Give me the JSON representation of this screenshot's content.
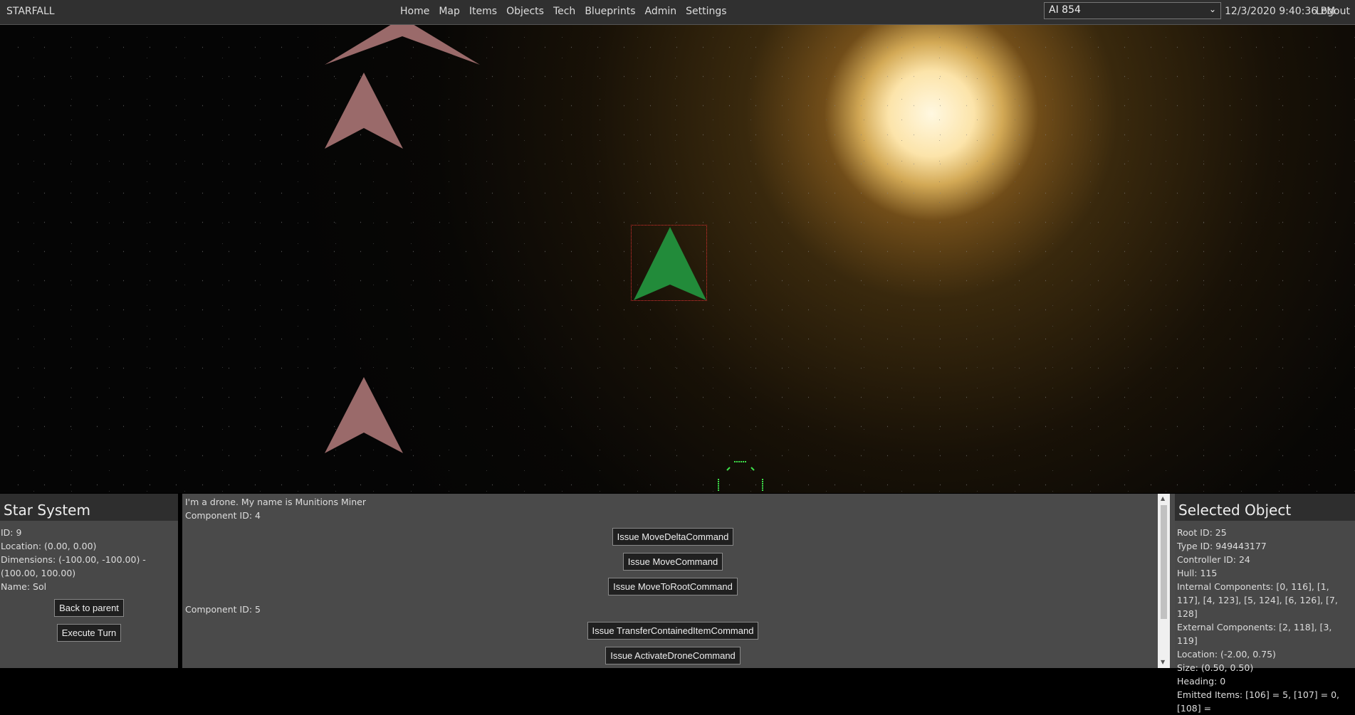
{
  "navbar": {
    "brand": "STARFALL",
    "links": [
      "Home",
      "Map",
      "Items",
      "Objects",
      "Tech",
      "Blueprints",
      "Admin",
      "Settings"
    ],
    "user_select": "AI 854",
    "clock": "12/3/2020 9:40:36 PM",
    "logout": "Logout"
  },
  "viewport": {
    "colors": {
      "sun_core": "#fff8e1",
      "sun_glow": "#c08a30",
      "enemy_ship": "#9a6a6a",
      "player_ship": "#228b3a",
      "selection": "#e03030",
      "hud": "#3ee04a"
    }
  },
  "star_system": {
    "title": "Star System",
    "id": "ID: 9",
    "location": "Location: (0.00, 0.00)",
    "dimensions": "Dimensions: (-100.00, -100.00) - (100.00, 100.00)",
    "name": "Name: Sol",
    "back_button": "Back to parent",
    "execute_button": "Execute Turn"
  },
  "drone": {
    "intro": "I'm a drone. My name is Munitions Miner",
    "component4": "Component ID: 4",
    "btn_move_delta": "Issue MoveDeltaCommand",
    "btn_move": "Issue MoveCommand",
    "btn_move_root": "Issue MoveToRootCommand",
    "component5": "Component ID: 5",
    "btn_transfer": "Issue TransferContainedItemCommand",
    "btn_activate": "Issue ActivateDroneCommand"
  },
  "selected_object": {
    "title": "Selected Object",
    "root_id": "Root ID: 25",
    "type_id": "Type ID: 949443177",
    "controller_id": "Controller ID: 24",
    "hull": "Hull: 115",
    "internal": "Internal Components: [0, 116], [1, 117], [4, 123], [5, 124], [6, 126], [7, 128]",
    "external": "External Components: [2, 118], [3, 119]",
    "location": "Location: (-2.00, 0.75)",
    "size": "Size: (0.50, 0.50)",
    "heading": "Heading: 0",
    "emitted": "Emitted Items: [106] = 5, [107] = 0, [108] ="
  }
}
